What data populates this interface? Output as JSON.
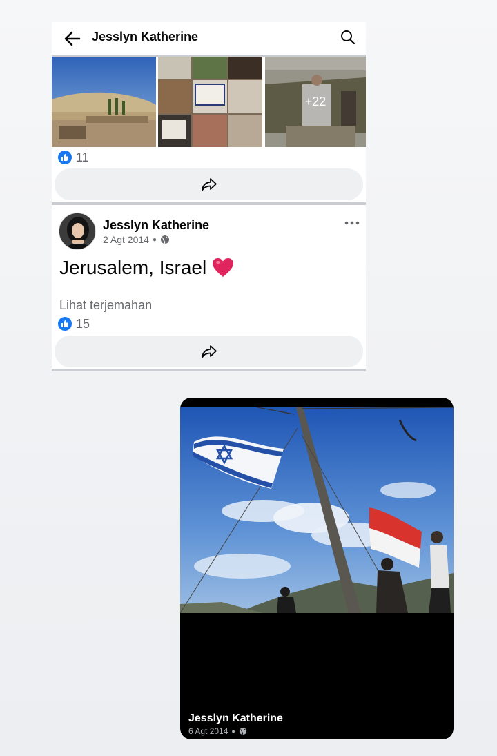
{
  "profile_header": {
    "title": "Jesslyn Katherine",
    "back_icon": "arrow-left-icon",
    "search_icon": "search-icon"
  },
  "album_post": {
    "photos_more_label": "+22",
    "like_count": "11",
    "share_icon": "share-icon"
  },
  "text_post": {
    "author": "Jesslyn Katherine",
    "date": "2 Agt 2014",
    "privacy_icon": "globe-icon",
    "text": "Jerusalem, Israel",
    "emoji": "heart-icon",
    "translate_label": "Lihat terjemahan",
    "like_count": "15"
  },
  "photo_viewer": {
    "author": "Jesslyn Katherine",
    "date": "6 Agt 2014",
    "privacy_icon": "globe-icon"
  },
  "colors": {
    "like_blue": "#1877f2",
    "heart_red": "#e0245e",
    "divider_gray": "#c9ccd1",
    "button_bg": "#eff0f2"
  }
}
